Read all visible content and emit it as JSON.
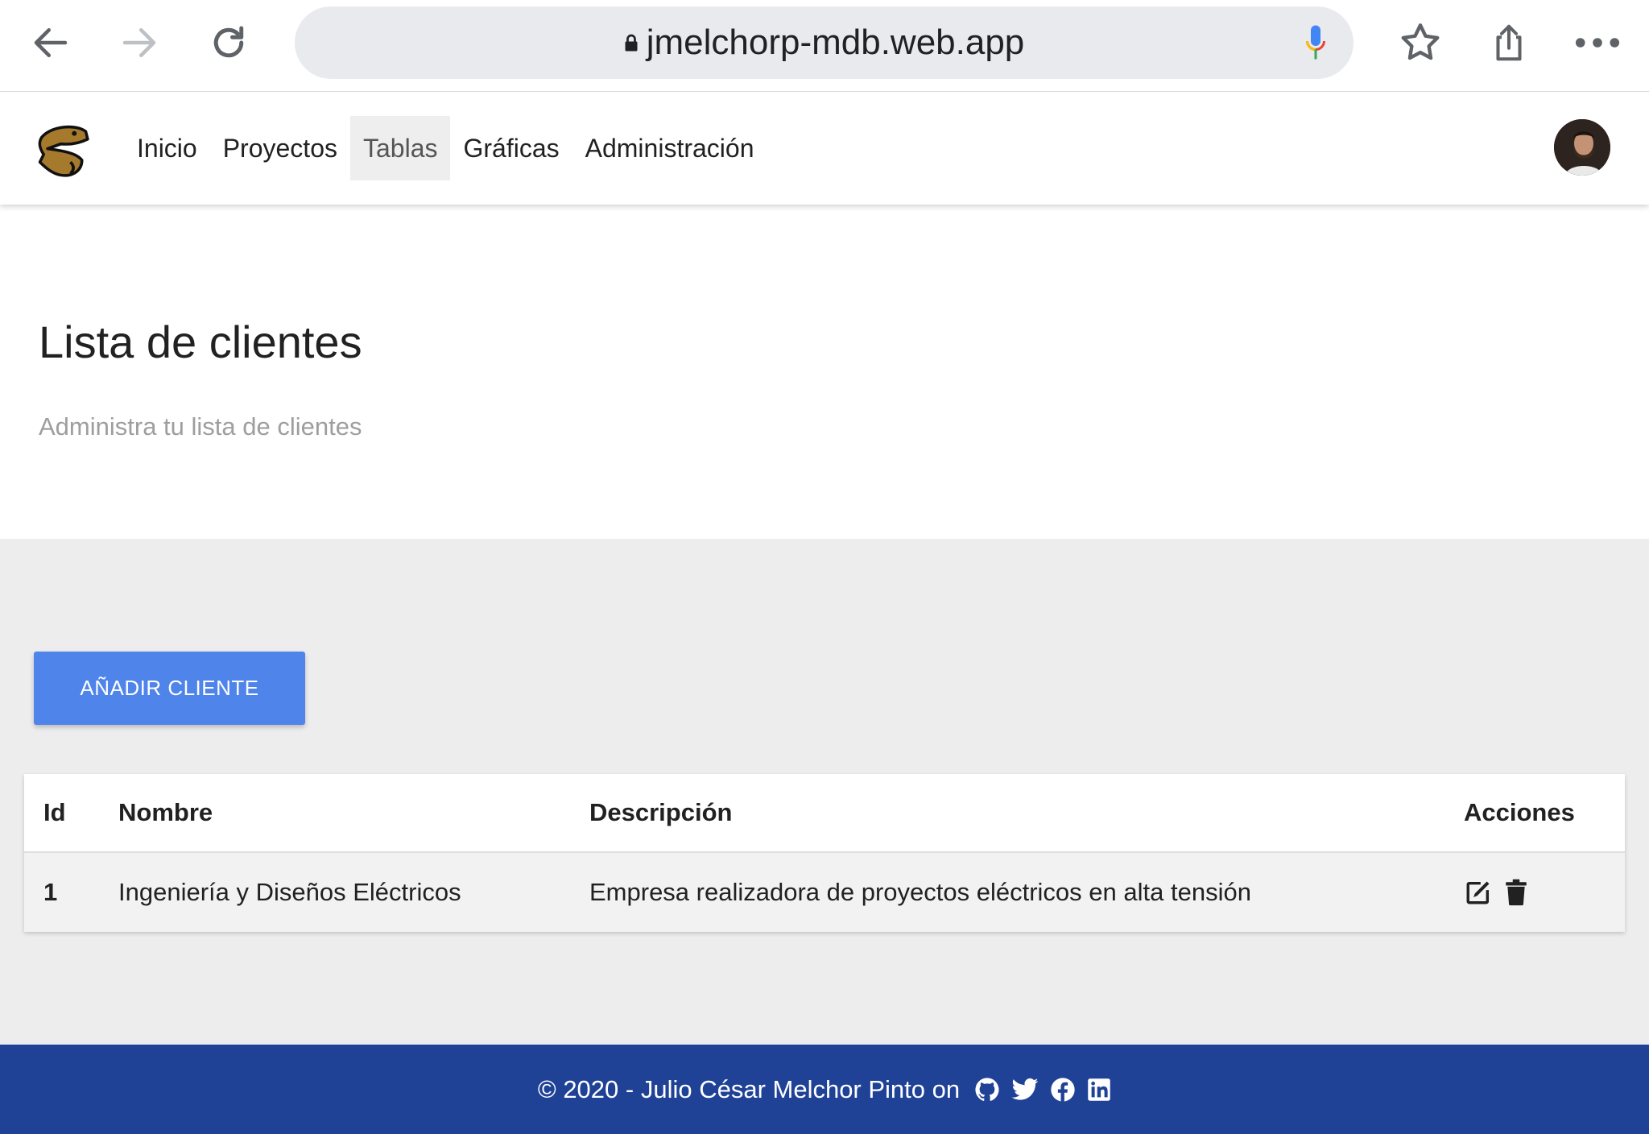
{
  "browser": {
    "url": "jmelchorp-mdb.web.app",
    "icons": [
      "back-arrow-icon",
      "forward-arrow-icon",
      "reload-icon",
      "lock-icon",
      "microphone-icon",
      "star-icon",
      "share-icon",
      "more-icon"
    ]
  },
  "navbar": {
    "logo": "beaver-logo",
    "links": [
      {
        "label": "Inicio",
        "active": false
      },
      {
        "label": "Proyectos",
        "active": false
      },
      {
        "label": "Tablas",
        "active": true
      },
      {
        "label": "Gráficas",
        "active": false
      },
      {
        "label": "Administración",
        "active": false
      }
    ]
  },
  "header": {
    "title": "Lista de clientes",
    "subtitle": "Administra tu lista de clientes"
  },
  "main": {
    "add_button_label": "AÑADIR CLIENTE",
    "table": {
      "columns": [
        "Id",
        "Nombre",
        "Descripción",
        "Acciones"
      ],
      "rows": [
        {
          "id": "1",
          "nombre": "Ingeniería y Diseños Eléctricos",
          "descripcion": "Empresa realizadora de proyectos eléctricos en alta tensión",
          "actions": [
            "edit-icon",
            "trash-icon"
          ]
        }
      ]
    }
  },
  "footer": {
    "text": "© 2020 - Julio César Melchor Pinto on",
    "social": [
      "github-icon",
      "twitter-icon",
      "facebook-icon",
      "linkedin-icon"
    ]
  },
  "colors": {
    "accent_button": "#4f84ea",
    "footer_bg": "#1f4297",
    "main_bg": "#ededee"
  }
}
